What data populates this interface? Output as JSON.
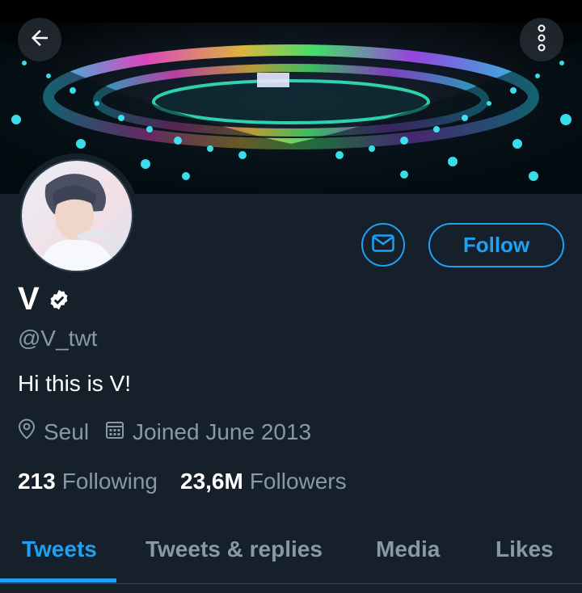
{
  "profile": {
    "name": "V",
    "handle": "@V_twt",
    "bio": "Hi this is V!",
    "location": "Seul",
    "joined": "Joined June 2013",
    "verified": true
  },
  "stats": {
    "following_count": "213",
    "following_label": "Following",
    "followers_count": "23,6M",
    "followers_label": "Followers"
  },
  "actions": {
    "follow_label": "Follow"
  },
  "tabs": [
    {
      "label": "Tweets",
      "active": true
    },
    {
      "label": "Tweets & replies",
      "active": false
    },
    {
      "label": "Media",
      "active": false
    },
    {
      "label": "Likes",
      "active": false
    }
  ],
  "icons": {
    "back": "arrow-left-icon",
    "more": "more-vertical-icon",
    "message": "envelope-icon",
    "verified": "verified-badge-icon",
    "location": "location-pin-icon",
    "calendar": "calendar-icon"
  },
  "colors": {
    "background": "#15202b",
    "accent": "#1da1f2",
    "secondary_text": "#8899a6",
    "primary_text": "#ffffff"
  }
}
